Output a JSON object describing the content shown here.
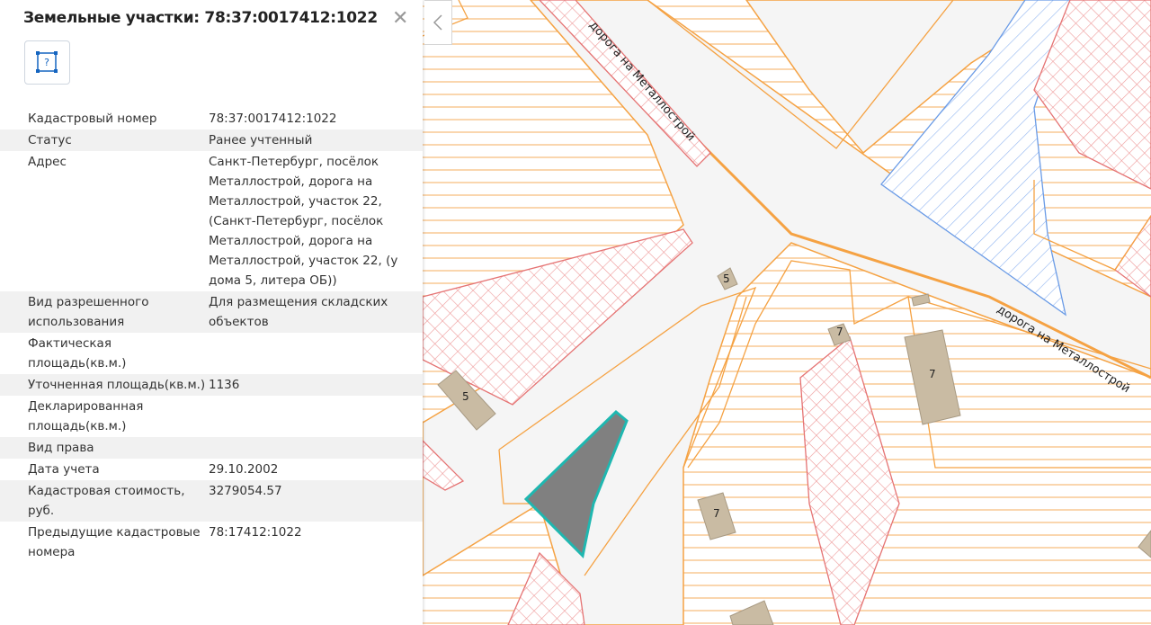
{
  "panel": {
    "title": "Земельные участки: 78:37:0017412:1022",
    "help_label": "?",
    "rows": [
      {
        "key": "Кадастровый номер",
        "value": "78:37:0017412:1022"
      },
      {
        "key": "Статус",
        "value": "Ранее учтенный"
      },
      {
        "key": "Адрес",
        "value": "Санкт-Петербург, посёлок Металлострой, дорога на Металлострой, участок 22, (Санкт-Петербург, посёлок Металлострой, дорога на Металлострой, участок 22, (у дома 5, литера ОБ))"
      },
      {
        "key": "Вид разрешенного использования",
        "value": "Для размещения складских объектов"
      },
      {
        "key": "Фактическая площадь(кв.м.)",
        "value": ""
      },
      {
        "key": "Уточненная площадь(кв.м.)",
        "value": "1136"
      },
      {
        "key": "Декларированная площадь(кв.м.)",
        "value": ""
      },
      {
        "key": "Вид права",
        "value": ""
      },
      {
        "key": "Дата учета",
        "value": "29.10.2002"
      },
      {
        "key": "Кадастровая стоимость, руб.",
        "value": "3279054.57"
      },
      {
        "key": "Предыдущие кадастровые номера",
        "value": "78:17412:1022"
      }
    ]
  },
  "map": {
    "road_label": "дорога на Металлострой",
    "building_labels": [
      "5",
      "5",
      "7",
      "7",
      "7"
    ],
    "colors": {
      "parcel_orange": "#f5a243",
      "parcel_red": "#e57373",
      "parcel_blue": "#6a9be6",
      "selected_fill": "#808080",
      "selected_stroke": "#1fb7b0",
      "building": "#c9bba3",
      "road": "#f5f5f5"
    }
  }
}
